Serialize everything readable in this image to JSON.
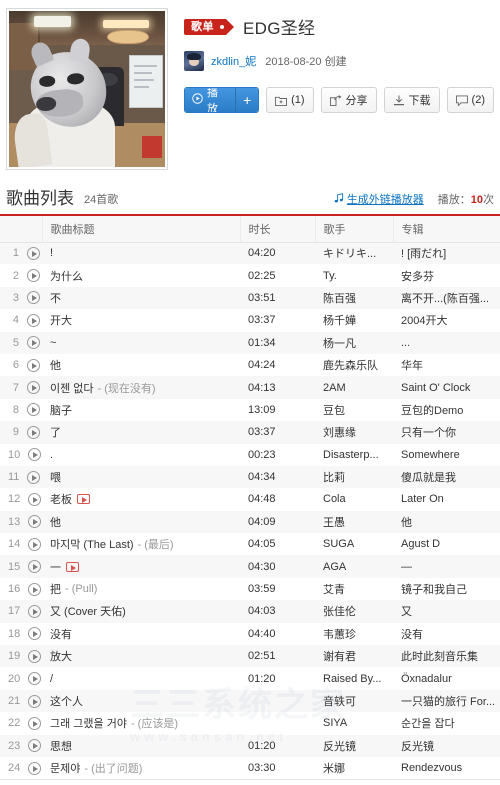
{
  "playlist": {
    "badge_label": "歌单",
    "title": "EDG圣经",
    "author": "zkdlin_妮",
    "created": "2018-08-20 创建",
    "cover_alt": "戴狗头面具的人"
  },
  "actions": {
    "play_label": "播放",
    "add_label": "+",
    "collect_label": "(1)",
    "share_label": "分享",
    "download_label": "下载",
    "comment_label": "(2)",
    "play_icon": "play-circle-icon",
    "collect_icon": "folder-add-icon",
    "share_icon": "share-icon",
    "download_icon": "download-icon",
    "comment_icon": "comment-icon"
  },
  "list_header": {
    "title": "歌曲列表",
    "count": "24首歌",
    "ext_player": "生成外链播放器",
    "ext_player_icon": "music-note-icon",
    "play_count_label": "播放：",
    "play_count_value": "10",
    "play_count_unit": "次"
  },
  "columns": {
    "index": "",
    "title": "歌曲标题",
    "duration": "时长",
    "artist": "歌手",
    "album": "专辑"
  },
  "songs": [
    {
      "idx": "1",
      "title": "!",
      "alias": "",
      "mv": false,
      "duration": "04:20",
      "artist": "キドリキ...",
      "album": "! [雨だれ]"
    },
    {
      "idx": "2",
      "title": "为什么",
      "alias": "",
      "mv": false,
      "duration": "02:25",
      "artist": "Ty.",
      "album": "安多芬"
    },
    {
      "idx": "3",
      "title": "不",
      "alias": "",
      "mv": false,
      "duration": "03:51",
      "artist": "陈百强",
      "album": "离不开...(陈百强..."
    },
    {
      "idx": "4",
      "title": "开大",
      "alias": "",
      "mv": false,
      "duration": "03:37",
      "artist": "杨千嬅",
      "album": "2004开大"
    },
    {
      "idx": "5",
      "title": "~",
      "alias": "",
      "mv": false,
      "duration": "01:34",
      "artist": "杨一凡",
      "album": "..."
    },
    {
      "idx": "6",
      "title": "他",
      "alias": "",
      "mv": false,
      "duration": "04:24",
      "artist": "鹿先森乐队",
      "album": "华年"
    },
    {
      "idx": "7",
      "title": "이젠 없다",
      "alias": "- (现在没有)",
      "mv": false,
      "duration": "04:13",
      "artist": "2AM",
      "album": "Saint O' Clock"
    },
    {
      "idx": "8",
      "title": "脑子",
      "alias": "",
      "mv": false,
      "duration": "13:09",
      "artist": "豆包",
      "album": "豆包的Demo"
    },
    {
      "idx": "9",
      "title": "了",
      "alias": "",
      "mv": false,
      "duration": "03:37",
      "artist": "刘惠缘",
      "album": "只有一个你"
    },
    {
      "idx": "10",
      "title": ".",
      "alias": "",
      "mv": false,
      "duration": "00:23",
      "artist": "Disasterp...",
      "album": "Somewhere"
    },
    {
      "idx": "11",
      "title": "喂",
      "alias": "",
      "mv": false,
      "duration": "04:34",
      "artist": "比莉",
      "album": "傻瓜就是我"
    },
    {
      "idx": "12",
      "title": "老板",
      "alias": "",
      "mv": true,
      "duration": "04:48",
      "artist": "Cola",
      "album": "Later On"
    },
    {
      "idx": "13",
      "title": "他",
      "alias": "",
      "mv": false,
      "duration": "04:09",
      "artist": "王愚",
      "album": "他"
    },
    {
      "idx": "14",
      "title": "마지막 (The Last)",
      "alias": "- (最后)",
      "mv": false,
      "duration": "04:05",
      "artist": "SUGA",
      "album": "Agust D"
    },
    {
      "idx": "15",
      "title": "一",
      "alias": "",
      "mv": true,
      "duration": "04:30",
      "artist": "AGA",
      "album": "—"
    },
    {
      "idx": "16",
      "title": "把",
      "alias": "- (Pull)",
      "mv": false,
      "duration": "03:59",
      "artist": "艾青",
      "album": "镜子和我自己"
    },
    {
      "idx": "17",
      "title": "又 (Cover 天佑)",
      "alias": "",
      "mv": false,
      "duration": "04:03",
      "artist": "张佳伦",
      "album": "又"
    },
    {
      "idx": "18",
      "title": "没有",
      "alias": "",
      "mv": false,
      "duration": "04:40",
      "artist": "韦蕙珍",
      "album": "没有"
    },
    {
      "idx": "19",
      "title": "放大",
      "alias": "",
      "mv": false,
      "duration": "02:51",
      "artist": "谢有君",
      "album": "此时此刻音乐集"
    },
    {
      "idx": "20",
      "title": "/",
      "alias": "",
      "mv": false,
      "duration": "01:20",
      "artist": "Raised By...",
      "album": "Öxnadalur"
    },
    {
      "idx": "21",
      "title": "这个人",
      "alias": "",
      "mv": false,
      "duration": "",
      "artist": "音轶可",
      "album": "一只猫的旅行 For..."
    },
    {
      "idx": "22",
      "title": "그래 그랬을 거야",
      "alias": "- (应该是)",
      "mv": false,
      "duration": "",
      "artist": "SIYA",
      "album": "순간을 잡다"
    },
    {
      "idx": "23",
      "title": "思想",
      "alias": "",
      "mv": false,
      "duration": "01:20",
      "artist": "反光镜",
      "album": "反光镜"
    },
    {
      "idx": "24",
      "title": "문제야",
      "alias": "- (出了问题)",
      "mv": false,
      "duration": "03:30",
      "artist": "米娜",
      "album": "Rendezvous"
    }
  ],
  "watermark": {
    "line1": "三三系统之家",
    "line2": "www.sansan.net"
  },
  "colors": {
    "brand_red": "#c8241c",
    "link_blue": "#0c73c2",
    "button_blue": "#2a7cc8"
  }
}
